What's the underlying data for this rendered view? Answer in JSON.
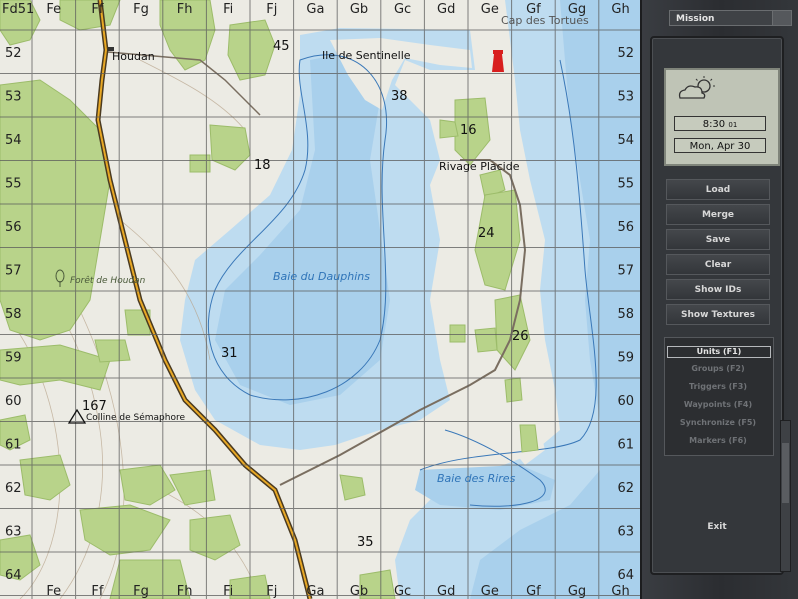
{
  "grid": {
    "col_labels": [
      "Fd",
      "Fe",
      "Ff",
      "Fg",
      "Fh",
      "Fi",
      "Fj",
      "Ga",
      "Gb",
      "Gc",
      "Gd",
      "Ge",
      "Gf",
      "Gg",
      "Gh"
    ],
    "row_labels": [
      "51",
      "52",
      "53",
      "54",
      "55",
      "56",
      "57",
      "58",
      "59",
      "60",
      "61",
      "62",
      "63",
      "64"
    ],
    "corner_label": "Fd51"
  },
  "map": {
    "heights": [
      "45",
      "38",
      "16",
      "18",
      "24",
      "26",
      "31",
      "167",
      "35"
    ],
    "places": {
      "houdan": "Houdan",
      "ile_sentinelle": "Ile de Sentinelle",
      "rivage_placide": "Rivage Placide",
      "colline": "Colline de Sémaphore",
      "foret": "Forêt de Houdan",
      "cap": "Cap des Tortues"
    },
    "water": {
      "baie_dauphins": "Baie du Dauphins",
      "baie_rires": "Baie des Rires"
    },
    "colors": {
      "land": "#ecebe4",
      "water": "#bedcf0",
      "water_deep": "#a9d0ec",
      "forest": "#b8d38a",
      "road": "#e8a825",
      "grid": "#5a5a5a"
    }
  },
  "panel": {
    "tab": "Mission",
    "time": "8:30",
    "time_suffix": "01",
    "date": "Mon, Apr 30",
    "weather_icon": "partly-cloudy-icon",
    "buttons": [
      "Load",
      "Merge",
      "Save",
      "Clear",
      "Show IDs",
      "Show Textures"
    ],
    "modes": [
      "Units (F1)",
      "Groups (F2)",
      "Triggers (F3)",
      "Waypoints (F4)",
      "Synchronize (F5)",
      "Markers (F6)"
    ],
    "active_mode": "Units (F1)",
    "exit": "Exit"
  }
}
